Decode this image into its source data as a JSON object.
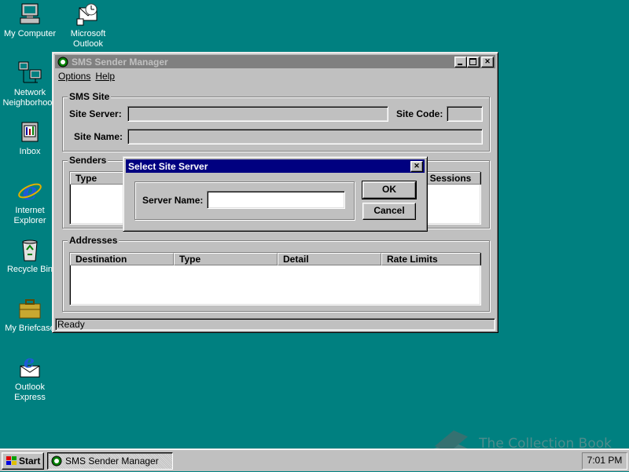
{
  "desktop": {
    "icons": [
      {
        "label_lines": [
          "My Computer"
        ]
      },
      {
        "label_lines": [
          "Microsoft",
          "Outlook"
        ]
      },
      {
        "label_lines": [
          "Network",
          "Neighborhood"
        ]
      },
      {
        "label_lines": [
          "Inbox"
        ]
      },
      {
        "label_lines": [
          "Internet",
          "Explorer"
        ]
      },
      {
        "label_lines": [
          "Recycle Bin"
        ]
      },
      {
        "label_lines": [
          "My Briefcase"
        ]
      },
      {
        "label_lines": [
          "Outlook",
          "Express"
        ]
      }
    ]
  },
  "main_window": {
    "title": "SMS Sender Manager",
    "menu": [
      "Options",
      "Help"
    ],
    "sms_site": {
      "group_label": "SMS Site",
      "site_server_label": "Site Server:",
      "site_code_label": "Site Code:",
      "site_name_label": "Site Name:",
      "site_server_value": "",
      "site_code_value": "",
      "site_name_value": ""
    },
    "senders": {
      "group_label": "Senders",
      "columns": [
        "Type",
        "nt Sessions"
      ]
    },
    "addresses": {
      "group_label": "Addresses",
      "columns": [
        "Destination",
        "Type",
        "Detail",
        "Rate Limits"
      ]
    },
    "status": "Ready"
  },
  "dialog": {
    "title": "Select Site Server",
    "server_name_label": "Server Name:",
    "server_name_value": "",
    "ok_label": "OK",
    "cancel_label": "Cancel"
  },
  "taskbar": {
    "start_label": "Start",
    "task_label": "SMS Sender Manager",
    "clock": "7:01 PM"
  },
  "watermark": "The Collection Book"
}
